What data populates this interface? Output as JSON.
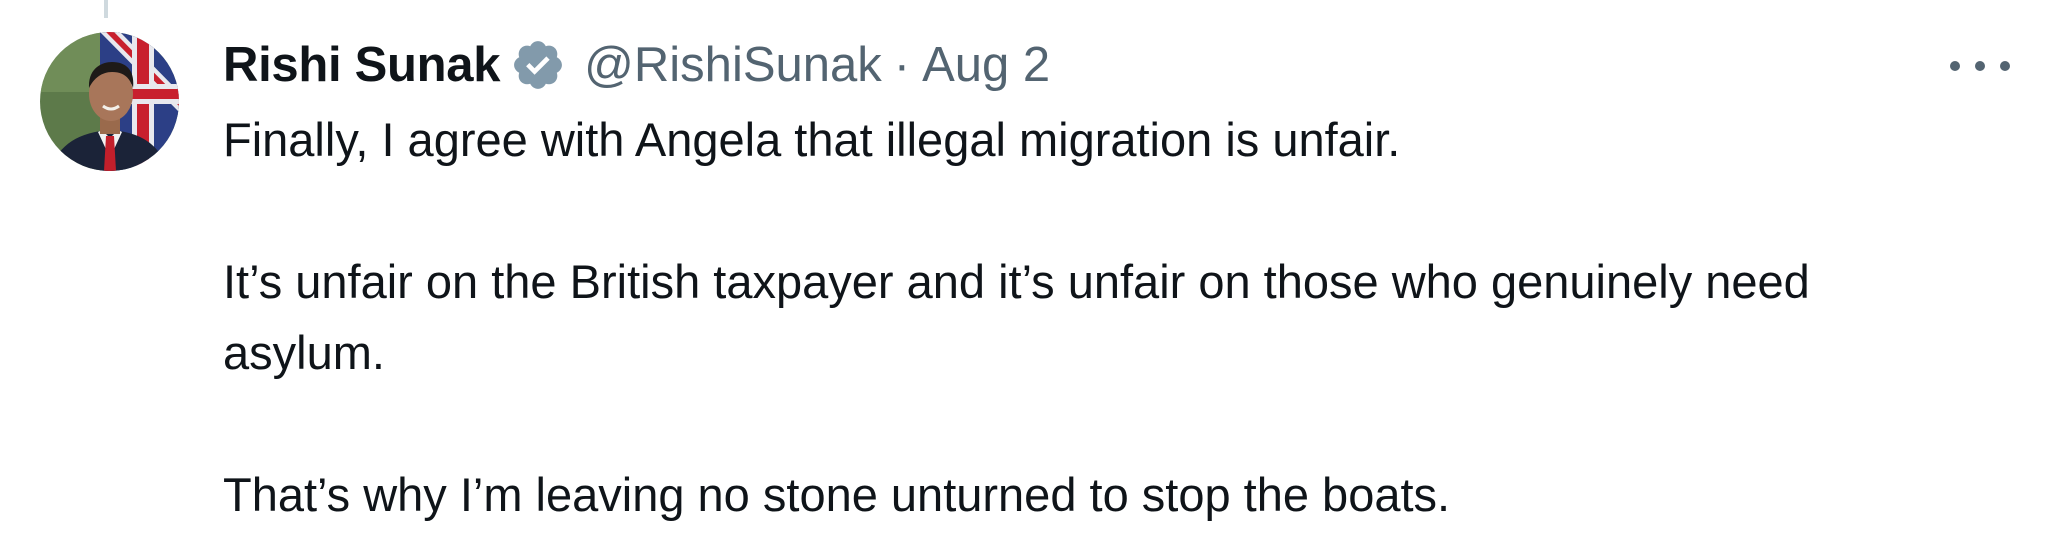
{
  "tweet": {
    "author": {
      "display_name": "Rishi Sunak",
      "handle": "@RishiSunak",
      "verified": true,
      "avatar_icon": "profile-photo"
    },
    "separator": "·",
    "date": "Aug 2",
    "more_icon": "more-horizontal-icon",
    "paragraphs": [
      "Finally, I agree with Angela that illegal migration is unfair.",
      "It’s unfair on the British taxpayer and it’s unfair on those who genuinely need asylum.",
      "That’s why I’m leaving no stone unturned to stop the boats."
    ]
  },
  "colors": {
    "text_primary": "#0f1419",
    "text_secondary": "#536471",
    "verified_badge": "#829aab",
    "thread_line": "#cfd9de"
  }
}
